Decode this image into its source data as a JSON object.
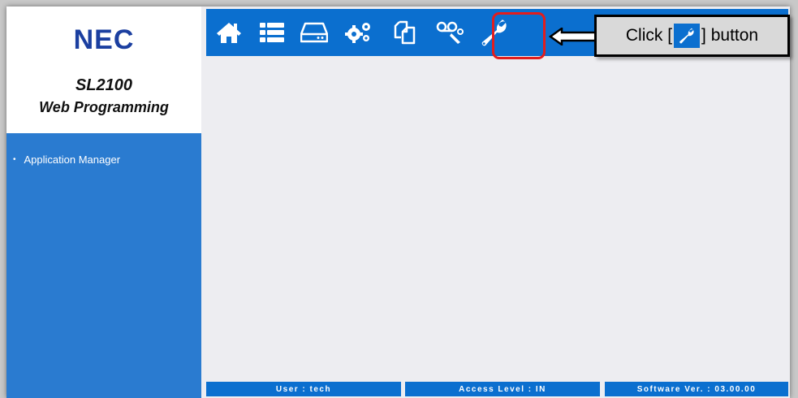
{
  "brand": {
    "logo": "NEC",
    "product": "SL2100",
    "subtitle": "Web Programming"
  },
  "sidebar": {
    "items": [
      {
        "label": "Application Manager",
        "icon": "bullet"
      }
    ]
  },
  "toolbar": {
    "buttons": [
      {
        "name": "home",
        "icon": "home-icon"
      },
      {
        "name": "list",
        "icon": "list-icon"
      },
      {
        "name": "storage",
        "icon": "drive-icon"
      },
      {
        "name": "settings",
        "icon": "gears-icon"
      },
      {
        "name": "copy",
        "icon": "copy-icon"
      },
      {
        "name": "voicemail",
        "icon": "voicemail-icon"
      },
      {
        "name": "maintenance",
        "icon": "wrench-icon",
        "highlighted": true
      }
    ]
  },
  "callout": {
    "prefix": "Click [",
    "suffix": "] button"
  },
  "status": {
    "user": "User : tech",
    "access": "Access Level : IN",
    "software": "Software Ver. : 03.00.00"
  },
  "colors": {
    "primary": "#0b6fcf",
    "sidebar": "#2a7bd0",
    "highlight": "#e21d1d",
    "logo": "#1b3fa0"
  }
}
